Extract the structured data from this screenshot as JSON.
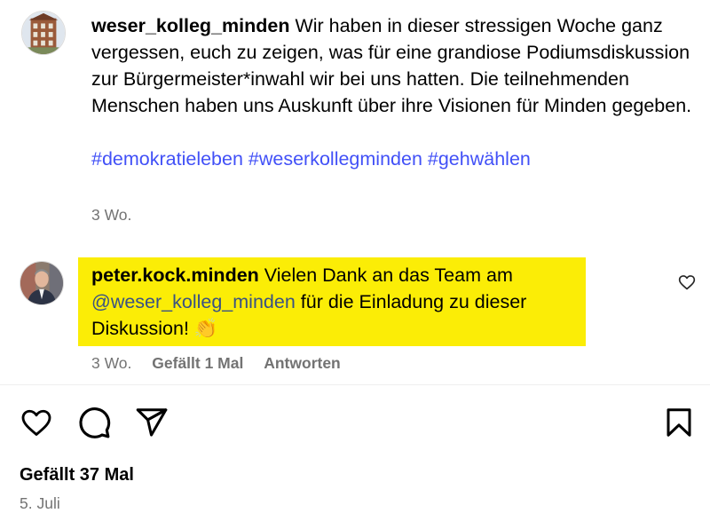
{
  "caption": {
    "username": "weser_kolleg_minden",
    "text": "Wir haben in dieser stressigen Woche ganz vergessen, euch zu zeigen, was für eine grandiose Podiumsdiskussion zur Bürgermeister*inwahl wir bei uns hatten. Die teilnehmenden Menschen haben uns Auskunft über ihre Visionen für Minden gegeben.",
    "hashtags": [
      "#demokratieleben",
      "#weserkollegminden",
      "#gehwählen"
    ],
    "time": "3 Wo."
  },
  "comment": {
    "username": "peter.kock.minden",
    "text_before": "Vielen Dank an das Team am",
    "mention": "@weser_kolleg_minden",
    "text_after": "für die Einladung zu dieser Diskussion! 👏",
    "time": "3 Wo.",
    "likes_label": "Gefällt 1 Mal",
    "reply_label": "Antworten",
    "highlight_color": "#fbed06"
  },
  "actions": {
    "like_icon": "heart-icon",
    "comment_icon": "comment-icon",
    "share_icon": "send-icon",
    "save_icon": "bookmark-icon"
  },
  "post": {
    "likes": "Gefällt 37 Mal",
    "date": "5. Juli"
  },
  "colors": {
    "link": "#4150f7",
    "mention": "#385185",
    "secondary_text": "#737373"
  }
}
